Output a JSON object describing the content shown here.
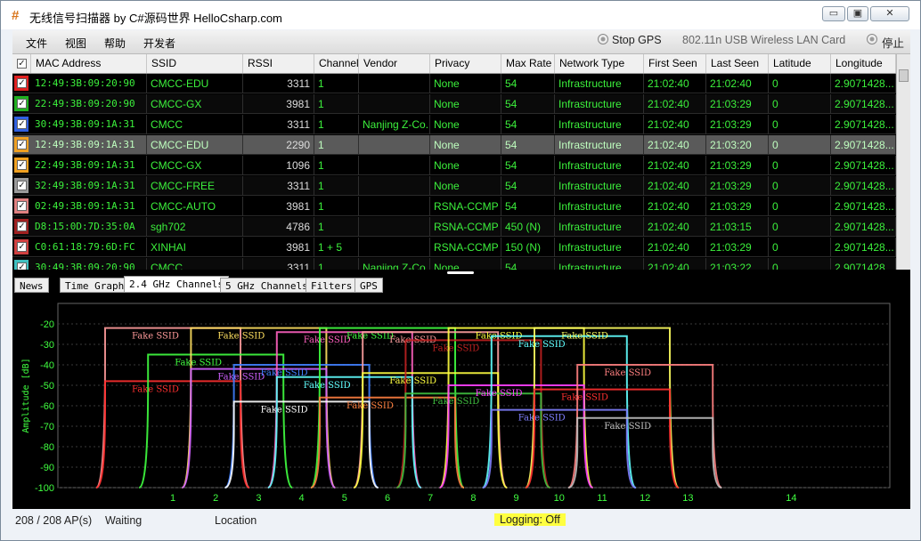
{
  "window": {
    "title": "无线信号扫描器 by C#源码世界 HelloCsharp.com",
    "icon": "hash-icon",
    "buttons": {
      "minimize": "▭",
      "restore": "▣",
      "close": "✕"
    }
  },
  "menubar": {
    "items": [
      "文件",
      "视图",
      "帮助",
      "开发者"
    ],
    "stop_gps": "Stop GPS",
    "adapter": "802.11n USB Wireless LAN Card",
    "stop": "停止"
  },
  "grid": {
    "columns": [
      "MAC Address",
      "SSID",
      "RSSI",
      "Channel",
      "Vendor",
      "Privacy",
      "Max Rate",
      "Network Type",
      "First Seen",
      "Last Seen",
      "Latitude",
      "Longitude"
    ],
    "rows": [
      {
        "color": "#e02020",
        "mac": "12:49:3B:09:20:90",
        "ssid": "CMCC-EDU",
        "rssi": "3311",
        "channel": "1",
        "vendor": "",
        "privacy": "None",
        "rate": "54",
        "type": "Infrastructure",
        "first": "21:02:40",
        "last": "21:02:40",
        "lat": "0",
        "lon": "2.9071428..."
      },
      {
        "color": "#20b020",
        "mac": "22:49:3B:09:20:90",
        "ssid": "CMCC-GX",
        "rssi": "3981",
        "channel": "1",
        "vendor": "",
        "privacy": "None",
        "rate": "54",
        "type": "Infrastructure",
        "first": "21:02:40",
        "last": "21:03:29",
        "lat": "0",
        "lon": "2.9071428..."
      },
      {
        "color": "#3060e0",
        "mac": "30:49:3B:09:1A:31",
        "ssid": "CMCC",
        "rssi": "3311",
        "channel": "1",
        "vendor": "Nanjing Z-Co...",
        "privacy": "None",
        "rate": "54",
        "type": "Infrastructure",
        "first": "21:02:40",
        "last": "21:03:29",
        "lat": "0",
        "lon": "2.9071428..."
      },
      {
        "color": "#f0a020",
        "mac": "12:49:3B:09:1A:31",
        "ssid": "CMCC-EDU",
        "rssi": "2290",
        "channel": "1",
        "vendor": "",
        "privacy": "None",
        "rate": "54",
        "type": "Infrastructure",
        "first": "21:02:40",
        "last": "21:03:20",
        "lat": "0",
        "lon": "2.9071428...",
        "selected": true
      },
      {
        "color": "#f0a020",
        "mac": "22:49:3B:09:1A:31",
        "ssid": "CMCC-GX",
        "rssi": "1096",
        "channel": "1",
        "vendor": "",
        "privacy": "None",
        "rate": "54",
        "type": "Infrastructure",
        "first": "21:02:40",
        "last": "21:03:29",
        "lat": "0",
        "lon": "2.9071428..."
      },
      {
        "color": "#9a9a9a",
        "mac": "32:49:3B:09:1A:31",
        "ssid": "CMCC-FREE",
        "rssi": "3311",
        "channel": "1",
        "vendor": "",
        "privacy": "None",
        "rate": "54",
        "type": "Infrastructure",
        "first": "21:02:40",
        "last": "21:03:29",
        "lat": "0",
        "lon": "2.9071428..."
      },
      {
        "color": "#e08080",
        "mac": "02:49:3B:09:1A:31",
        "ssid": "CMCC-AUTO",
        "rssi": "3981",
        "channel": "1",
        "vendor": "",
        "privacy": "RSNA-CCMP",
        "rate": "54",
        "type": "Infrastructure",
        "first": "21:02:40",
        "last": "21:03:29",
        "lat": "0",
        "lon": "2.9071428..."
      },
      {
        "color": "#a02020",
        "mac": "D8:15:0D:7D:35:0A",
        "ssid": "sgh702",
        "rssi": "4786",
        "channel": "1",
        "vendor": "",
        "privacy": "RSNA-CCMP",
        "rate": "450 (N)",
        "type": "Infrastructure",
        "first": "21:02:40",
        "last": "21:03:15",
        "lat": "0",
        "lon": "2.9071428..."
      },
      {
        "color": "#d04040",
        "mac": "C0:61:18:79:6D:FC",
        "ssid": "XINHAI",
        "rssi": "3981",
        "channel": "1 + 5",
        "vendor": "",
        "privacy": "RSNA-CCMP",
        "rate": "150 (N)",
        "type": "Infrastructure",
        "first": "21:02:40",
        "last": "21:03:29",
        "lat": "0",
        "lon": "2.9071428..."
      },
      {
        "color": "#40c0c0",
        "mac": "30:49:3B:09:20:90",
        "ssid": "CMCC",
        "rssi": "3311",
        "channel": "1",
        "vendor": "Nanjing Z-Co...",
        "privacy": "None",
        "rate": "54",
        "type": "Infrastructure",
        "first": "21:02:40",
        "last": "21:03:22",
        "lat": "0",
        "lon": "2.9071428..."
      }
    ]
  },
  "tabs": [
    "News",
    "Time Graph",
    "2.4 GHz Channels",
    "5 GHz Channels",
    "Filters",
    "GPS"
  ],
  "active_tab": "2.4 GHz Channels",
  "chart_data": {
    "type": "area",
    "ylabel": "Amplitude [dB]",
    "ylim": [
      -100,
      -10
    ],
    "yticks": [
      -20,
      -30,
      -40,
      -50,
      -60,
      -70,
      -80,
      -90,
      -100
    ],
    "xticks": [
      "1",
      "2",
      "3",
      "4",
      "5",
      "6",
      "7",
      "8",
      "9",
      "10",
      "11",
      "12",
      "13",
      "14"
    ],
    "grid": true,
    "label": "Fake SSID",
    "series": [
      {
        "channel": 1,
        "level": -22,
        "color": "#ff9a9a"
      },
      {
        "channel": 1,
        "level": -48,
        "color": "#ff3030"
      },
      {
        "channel": 2,
        "level": -35,
        "color": "#40ff40"
      },
      {
        "channel": 3,
        "level": -22,
        "color": "#ffe060"
      },
      {
        "channel": 3,
        "level": -42,
        "color": "#d060ff"
      },
      {
        "channel": 4,
        "level": -40,
        "color": "#4080ff"
      },
      {
        "channel": 4,
        "level": -58,
        "color": "#ffffff"
      },
      {
        "channel": 5,
        "level": -24,
        "color": "#ff60c0"
      },
      {
        "channel": 5,
        "level": -46,
        "color": "#60ffff"
      },
      {
        "channel": 6,
        "level": -22,
        "color": "#40ff40"
      },
      {
        "channel": 6,
        "level": -56,
        "color": "#ff8040"
      },
      {
        "channel": 7,
        "level": -24,
        "color": "#ffa0a0"
      },
      {
        "channel": 7,
        "level": -44,
        "color": "#ffff40"
      },
      {
        "channel": 8,
        "level": -28,
        "color": "#c02020"
      },
      {
        "channel": 8,
        "level": -54,
        "color": "#40c040"
      },
      {
        "channel": 9,
        "level": -22,
        "color": "#ffff40"
      },
      {
        "channel": 9,
        "level": -50,
        "color": "#ff40ff"
      },
      {
        "channel": 10,
        "level": -26,
        "color": "#60ffff"
      },
      {
        "channel": 10,
        "level": -62,
        "color": "#8080ff"
      },
      {
        "channel": 11,
        "level": -22,
        "color": "#ffff60"
      },
      {
        "channel": 11,
        "level": -52,
        "color": "#ff3030"
      },
      {
        "channel": 12,
        "level": -40,
        "color": "#ff8080"
      },
      {
        "channel": 12,
        "level": -66,
        "color": "#c0c0c0"
      }
    ]
  },
  "statusbar": {
    "ap_count": "208 / 208 AP(s)",
    "state": "Waiting",
    "location": "Location",
    "logging": "Logging: Off"
  }
}
